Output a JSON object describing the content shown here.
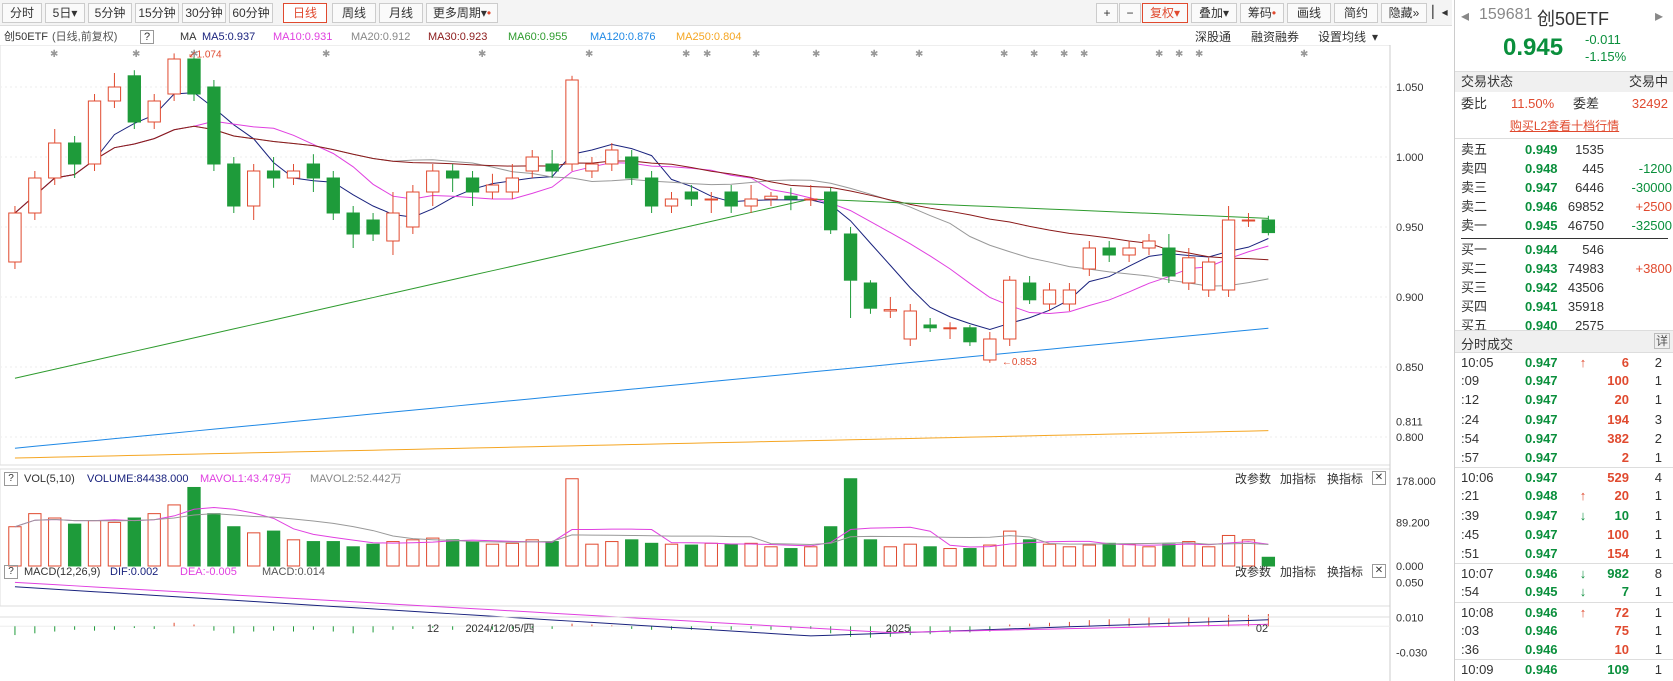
{
  "toolbar": {
    "periods": [
      "分时",
      "5日",
      "5分钟",
      "15分钟",
      "30分钟",
      "60分钟",
      "日线",
      "周线",
      "月线",
      "更多周期"
    ],
    "active_period": "日线",
    "plus": "+",
    "minus": "−",
    "fuquan": "复权",
    "diejia": "叠加",
    "chouma": "筹码",
    "huaxian": "画线",
    "jianyue": "简约",
    "yincang": "隐藏"
  },
  "info": {
    "name": "创50ETF",
    "mode": "(日线,前复权)",
    "help": "?",
    "ma_label": "MA",
    "ma5": "MA5:0.937",
    "ma10": "MA10:0.931",
    "ma20": "MA20:0.912",
    "ma30": "MA30:0.923",
    "ma60": "MA60:0.955",
    "ma120": "MA120:0.876",
    "ma250": "MA250:0.804",
    "shengutong": "深股通",
    "rongzi": "融资融券",
    "setting": "设置均线"
  },
  "colors": {
    "up": "#e04a2f",
    "down": "#1e9b3a",
    "ma5": "#1a237e",
    "ma10": "#e040e0",
    "ma20": "#999999",
    "ma30": "#8b1a1a",
    "ma60": "#2e9b2e",
    "ma120": "#1e88e5",
    "ma250": "#f5a623"
  },
  "price_axis": {
    "labels": [
      "1.050",
      "1.000",
      "0.950",
      "0.900",
      "0.850",
      "0.811",
      "0.800"
    ],
    "high_note": "1.074",
    "low_note": "0.853"
  },
  "vol": {
    "title": "VOL(5,10)",
    "volume": "VOLUME:84438.000",
    "mavol1": "MAVOL1:43.479万",
    "mavol2": "MAVOL2:52.442万",
    "axis": [
      "178.000",
      "89.200",
      "0.000"
    ]
  },
  "macd": {
    "title": "MACD(12,26,9)",
    "dif": "DIF:0.002",
    "dea": "DEA:-0.005",
    "macd": "MACD:0.014",
    "axis": [
      "0.050",
      "0.010",
      "-0.030"
    ]
  },
  "panel_links": {
    "gai": "改参数",
    "jia": "加指标",
    "huan": "换指标",
    "close": "✕"
  },
  "date_axis": [
    "12",
    "2024/12/05/四",
    "2025",
    "02"
  ],
  "quote": {
    "code": "159681",
    "name": "创50ETF",
    "price": "0.945",
    "change": "-0.011",
    "pct": "-1.15%",
    "status_label": "交易状态",
    "status": "交易中",
    "weibi_label": "委比",
    "weibi": "11.50%",
    "weicha_label": "委差",
    "weicha": "32492",
    "l2": "购买L2查看十档行情",
    "asks": [
      {
        "k": "卖五",
        "p": "0.949",
        "v": "1535",
        "c": ""
      },
      {
        "k": "卖四",
        "p": "0.948",
        "v": "445",
        "c": "-1200"
      },
      {
        "k": "卖三",
        "p": "0.947",
        "v": "6446",
        "c": "-30000"
      },
      {
        "k": "卖二",
        "p": "0.946",
        "v": "69852",
        "c": "+2500"
      },
      {
        "k": "卖一",
        "p": "0.945",
        "v": "46750",
        "c": "-32500"
      }
    ],
    "bids": [
      {
        "k": "买一",
        "p": "0.944",
        "v": "546",
        "c": ""
      },
      {
        "k": "买二",
        "p": "0.943",
        "v": "74983",
        "c": "+3800"
      },
      {
        "k": "买三",
        "p": "0.942",
        "v": "43506",
        "c": ""
      },
      {
        "k": "买四",
        "p": "0.941",
        "v": "35918",
        "c": ""
      },
      {
        "k": "买五",
        "p": "0.940",
        "v": "2575",
        "c": ""
      }
    ],
    "ticks_title": "分时成交",
    "ticks_detail": "详",
    "ticks": [
      {
        "t": "10:05",
        "p": "0.947",
        "a": "↑",
        "q": "6",
        "n": "2",
        "col": "up"
      },
      {
        "t": ":09",
        "p": "0.947",
        "a": "",
        "q": "100",
        "n": "1",
        "col": "up"
      },
      {
        "t": ":12",
        "p": "0.947",
        "a": "",
        "q": "20",
        "n": "1",
        "col": "up"
      },
      {
        "t": ":24",
        "p": "0.947",
        "a": "",
        "q": "194",
        "n": "3",
        "col": "up"
      },
      {
        "t": ":54",
        "p": "0.947",
        "a": "",
        "q": "382",
        "n": "2",
        "col": "up"
      },
      {
        "t": ":57",
        "p": "0.947",
        "a": "",
        "q": "2",
        "n": "1",
        "col": "up"
      },
      {
        "t": "10:06",
        "p": "0.947",
        "a": "",
        "q": "529",
        "n": "4",
        "col": "up"
      },
      {
        "t": ":21",
        "p": "0.948",
        "a": "↑",
        "q": "20",
        "n": "1",
        "col": "up"
      },
      {
        "t": ":39",
        "p": "0.947",
        "a": "↓",
        "q": "10",
        "n": "1",
        "col": "dn"
      },
      {
        "t": ":45",
        "p": "0.947",
        "a": "",
        "q": "100",
        "n": "1",
        "col": "up"
      },
      {
        "t": ":51",
        "p": "0.947",
        "a": "",
        "q": "154",
        "n": "1",
        "col": "up"
      },
      {
        "t": "10:07",
        "p": "0.946",
        "a": "↓",
        "q": "982",
        "n": "8",
        "col": "dn"
      },
      {
        "t": ":54",
        "p": "0.945",
        "a": "↓",
        "q": "7",
        "n": "1",
        "col": "dn"
      },
      {
        "t": "10:08",
        "p": "0.946",
        "a": "↑",
        "q": "72",
        "n": "1",
        "col": "up"
      },
      {
        "t": ":03",
        "p": "0.946",
        "a": "",
        "q": "75",
        "n": "1",
        "col": "up"
      },
      {
        "t": ":36",
        "p": "0.946",
        "a": "",
        "q": "10",
        "n": "1",
        "col": "up"
      },
      {
        "t": "10:09",
        "p": "0.946",
        "a": "",
        "q": "109",
        "n": "1",
        "col": "dn"
      }
    ]
  },
  "chart_data": {
    "type": "candlestick",
    "candles": [
      [
        0.925,
        0.96,
        0.965,
        0.92
      ],
      [
        0.96,
        0.985,
        0.99,
        0.955
      ],
      [
        0.985,
        1.01,
        1.02,
        0.98
      ],
      [
        1.01,
        0.995,
        1.015,
        0.985
      ],
      [
        0.995,
        1.04,
        1.045,
        0.99
      ],
      [
        1.04,
        1.05,
        1.06,
        1.035
      ],
      [
        1.058,
        1.025,
        1.062,
        1.02
      ],
      [
        1.025,
        1.04,
        1.045,
        1.02
      ],
      [
        1.045,
        1.07,
        1.074,
        1.04
      ],
      [
        1.07,
        1.045,
        1.072,
        1.04
      ],
      [
        1.05,
        0.995,
        1.055,
        0.99
      ],
      [
        0.995,
        0.965,
        1.0,
        0.96
      ],
      [
        0.965,
        0.99,
        0.995,
        0.955
      ],
      [
        0.99,
        0.985,
        1.0,
        0.978
      ],
      [
        0.985,
        0.99,
        0.995,
        0.98
      ],
      [
        0.995,
        0.985,
        1.002,
        0.975
      ],
      [
        0.985,
        0.96,
        0.99,
        0.955
      ],
      [
        0.96,
        0.945,
        0.965,
        0.935
      ],
      [
        0.955,
        0.945,
        0.96,
        0.94
      ],
      [
        0.94,
        0.96,
        0.975,
        0.93
      ],
      [
        0.95,
        0.975,
        0.98,
        0.945
      ],
      [
        0.975,
        0.99,
        0.995,
        0.965
      ],
      [
        0.99,
        0.985,
        0.995,
        0.975
      ],
      [
        0.985,
        0.975,
        0.99,
        0.965
      ],
      [
        0.975,
        0.98,
        0.988,
        0.97
      ],
      [
        0.975,
        0.985,
        0.995,
        0.97
      ],
      [
        0.99,
        1.0,
        1.005,
        0.985
      ],
      [
        0.995,
        0.99,
        1.005,
        0.985
      ],
      [
        0.995,
        1.055,
        1.058,
        0.99
      ],
      [
        0.99,
        0.995,
        1.0,
        0.985
      ],
      [
        0.995,
        1.005,
        1.01,
        0.99
      ],
      [
        1.0,
        0.985,
        1.005,
        0.98
      ],
      [
        0.985,
        0.965,
        0.99,
        0.96
      ],
      [
        0.965,
        0.97,
        0.975,
        0.96
      ],
      [
        0.975,
        0.97,
        0.98,
        0.965
      ],
      [
        0.97,
        0.97,
        0.975,
        0.96
      ],
      [
        0.975,
        0.965,
        0.98,
        0.96
      ],
      [
        0.965,
        0.97,
        0.98,
        0.96
      ],
      [
        0.97,
        0.972,
        0.975,
        0.965
      ],
      [
        0.972,
        0.97,
        0.978,
        0.962
      ],
      [
        0.97,
        0.97,
        0.98,
        0.965
      ],
      [
        0.975,
        0.948,
        0.978,
        0.945
      ],
      [
        0.945,
        0.912,
        0.95,
        0.885
      ],
      [
        0.91,
        0.892,
        0.912,
        0.888
      ],
      [
        0.89,
        0.891,
        0.9,
        0.885
      ],
      [
        0.87,
        0.89,
        0.895,
        0.865
      ],
      [
        0.88,
        0.878,
        0.885,
        0.875
      ],
      [
        0.878,
        0.878,
        0.882,
        0.87
      ],
      [
        0.878,
        0.868,
        0.88,
        0.865
      ],
      [
        0.855,
        0.87,
        0.875,
        0.853
      ],
      [
        0.87,
        0.912,
        0.915,
        0.865
      ],
      [
        0.91,
        0.898,
        0.915,
        0.895
      ],
      [
        0.895,
        0.905,
        0.91,
        0.89
      ],
      [
        0.895,
        0.905,
        0.91,
        0.89
      ],
      [
        0.92,
        0.935,
        0.94,
        0.915
      ],
      [
        0.935,
        0.93,
        0.94,
        0.925
      ],
      [
        0.93,
        0.935,
        0.94,
        0.925
      ],
      [
        0.935,
        0.94,
        0.945,
        0.93
      ],
      [
        0.935,
        0.915,
        0.945,
        0.91
      ],
      [
        0.91,
        0.928,
        0.935,
        0.905
      ],
      [
        0.905,
        0.925,
        0.928,
        0.9
      ],
      [
        0.905,
        0.955,
        0.965,
        0.9
      ],
      [
        0.955,
        0.955,
        0.96,
        0.95
      ],
      [
        0.955,
        0.946,
        0.958,
        0.944
      ]
    ],
    "volumes": [
      45,
      60,
      55,
      48,
      52,
      50,
      55,
      60,
      70,
      90,
      60,
      45,
      38,
      40,
      30,
      28,
      28,
      22,
      25,
      28,
      30,
      32,
      30,
      28,
      25,
      26,
      30,
      28,
      100,
      25,
      28,
      30,
      26,
      25,
      24,
      26,
      25,
      26,
      22,
      20,
      22,
      45,
      100,
      30,
      22,
      25,
      22,
      20,
      20,
      24,
      40,
      30,
      25,
      22,
      24,
      26,
      25,
      22,
      25,
      28,
      22,
      35,
      30,
      10
    ],
    "macd_hist": [
      -0.01,
      -0.008,
      -0.006,
      -0.004,
      -0.005,
      -0.004,
      -0.002,
      -0.003,
      0.004,
      0.002,
      -0.005,
      -0.008,
      -0.006,
      -0.005,
      -0.006,
      -0.004,
      -0.006,
      -0.008,
      -0.007,
      -0.004,
      -0.003,
      -0.002,
      -0.004,
      -0.005,
      -0.004,
      -0.003,
      -0.002,
      -0.003,
      0.003,
      0.002,
      0.001,
      -0.003,
      -0.004,
      -0.004,
      -0.004,
      -0.003,
      -0.004,
      -0.003,
      -0.004,
      -0.004,
      -0.003,
      -0.008,
      -0.012,
      -0.013,
      -0.012,
      -0.01,
      -0.009,
      -0.008,
      -0.007,
      -0.006,
      0.002,
      0.003,
      0.004,
      0.005,
      0.007,
      0.008,
      0.009,
      0.01,
      0.009,
      0.01,
      0.01,
      0.013,
      0.013,
      0.014
    ],
    "ylim": [
      0.78,
      1.08
    ]
  }
}
